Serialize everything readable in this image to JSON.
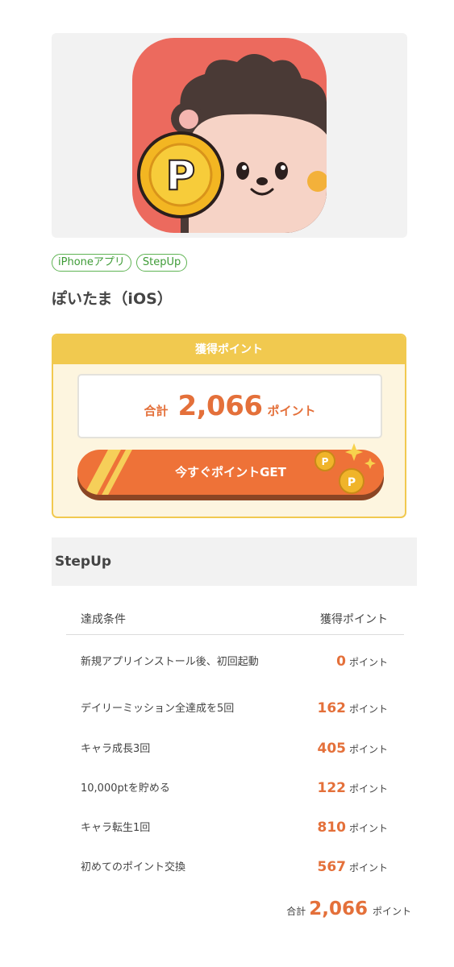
{
  "app": {
    "title": "ぽいたま（iOS）",
    "tags": [
      "iPhoneアプリ",
      "StepUp"
    ]
  },
  "points_box": {
    "header": "獲得ポイント",
    "total_label": "合計",
    "total_value": "2,066",
    "total_unit": "ポイント",
    "get_button_label": "今すぐポイントGET"
  },
  "stepup": {
    "title": "StepUp",
    "columns": [
      "達成条件",
      "獲得ポイント"
    ],
    "rows": [
      {
        "condition": "新規アプリインストール後、初回起動",
        "points": "0",
        "unit": "ポイント"
      },
      {
        "condition": "デイリーミッション全達成を5回",
        "points": "162",
        "unit": "ポイント"
      },
      {
        "condition": "キャラ成長3回",
        "points": "405",
        "unit": "ポイント"
      },
      {
        "condition": "10,000ptを貯める",
        "points": "122",
        "unit": "ポイント"
      },
      {
        "condition": "キャラ転生1回",
        "points": "810",
        "unit": "ポイント"
      },
      {
        "condition": "初めてのポイント交換",
        "points": "567",
        "unit": "ポイント"
      }
    ],
    "grand_total_label": "合計",
    "grand_total_value": "2,066",
    "grand_total_unit": "ポイント"
  },
  "colors": {
    "accent_orange": "#ee7238",
    "point_text": "#e4703a",
    "gold": "#f1c94f",
    "tag_green": "#5fb453",
    "icon_bg": "#ec6a5e"
  },
  "icons": [
    "app-icon-hedgehog",
    "coin-p-icon",
    "sparkle-icon"
  ]
}
